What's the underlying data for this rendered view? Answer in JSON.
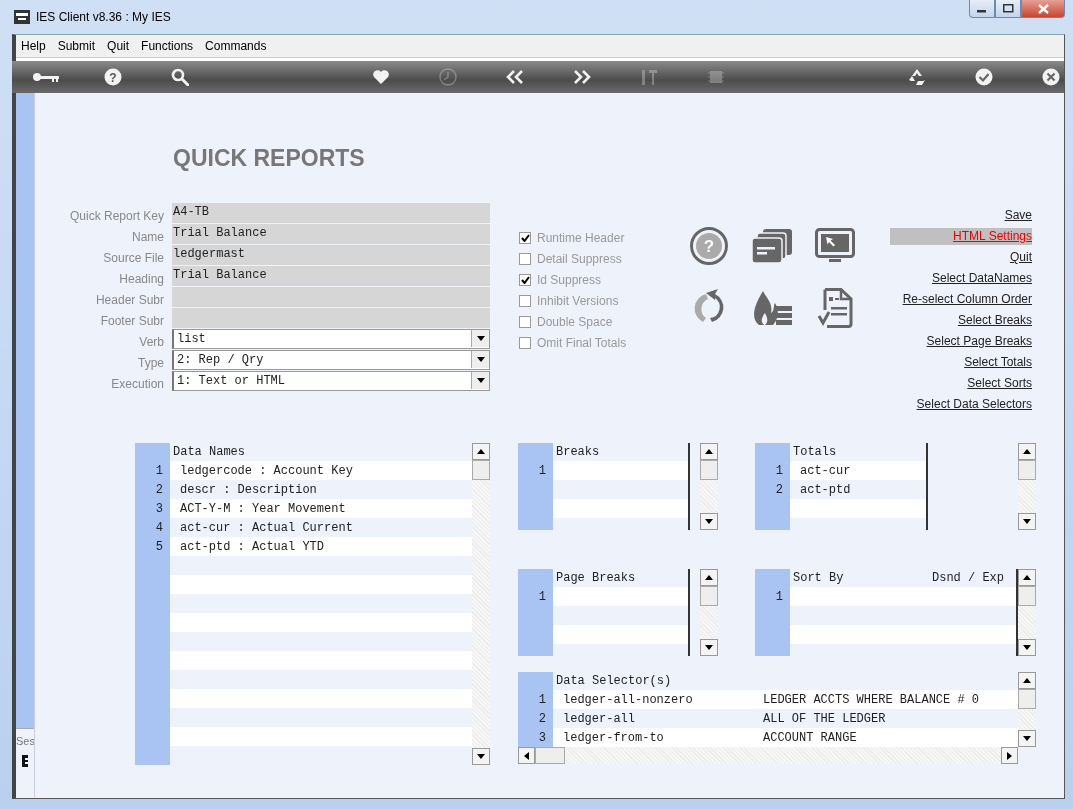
{
  "window": {
    "title": "IES Client v8.36 : My IES"
  },
  "menu": [
    "Help",
    "Submit",
    "Quit",
    "Functions",
    "Commands"
  ],
  "toolbar": {
    "left": [
      {
        "kind": "key",
        "disabled": false
      },
      {
        "kind": "help",
        "symbol": "?",
        "disabled": false
      },
      {
        "kind": "search",
        "disabled": false
      }
    ],
    "middle": [
      {
        "kind": "heart",
        "disabled": false
      },
      {
        "kind": "clock",
        "disabled": true
      },
      {
        "kind": "back",
        "disabled": false
      },
      {
        "kind": "forward",
        "disabled": false
      },
      {
        "kind": "tools",
        "disabled": true
      },
      {
        "kind": "chip",
        "disabled": true
      }
    ],
    "right": [
      {
        "kind": "recycle",
        "disabled": false
      },
      {
        "kind": "check",
        "disabled": false
      },
      {
        "kind": "close",
        "disabled": false
      }
    ]
  },
  "heading": "QUICK REPORTS",
  "fields": [
    {
      "label": "Quick Report Key",
      "value": "A4-TB",
      "kind": "text"
    },
    {
      "label": "Name",
      "value": "Trial Balance",
      "kind": "text"
    },
    {
      "label": "Source File",
      "value": "ledgermast",
      "kind": "text"
    },
    {
      "label": "Heading",
      "value": "Trial Balance",
      "kind": "text"
    },
    {
      "label": "Header Subr",
      "kind": "text"
    },
    {
      "label": "Footer Subr",
      "kind": "text"
    },
    {
      "label": "Verb",
      "value": "list",
      "kind": "dropdown"
    },
    {
      "label": "Type",
      "value": "2: Rep / Qry",
      "kind": "dropdown"
    },
    {
      "label": "Execution",
      "value": "1: Text or HTML",
      "kind": "dropdown"
    }
  ],
  "options": [
    {
      "label": "Runtime Header",
      "checked": true
    },
    {
      "label": "Detail Suppress",
      "checked": false
    },
    {
      "label": "Id Suppress",
      "checked": true
    },
    {
      "label": "Inhibit Versions",
      "checked": false
    },
    {
      "label": "Double Space",
      "checked": false
    },
    {
      "label": "Omit Final Totals",
      "checked": false
    }
  ],
  "action_icons": [
    {
      "kind": "help",
      "symbol": "?"
    },
    {
      "kind": "cards"
    },
    {
      "kind": "monitor"
    },
    {
      "kind": "refresh"
    },
    {
      "kind": "firewall"
    },
    {
      "kind": "checklist"
    }
  ],
  "links": [
    {
      "label": "Save",
      "selected": false
    },
    {
      "label": "HTML Settings",
      "selected": true
    },
    {
      "label": "Quit",
      "selected": false
    },
    {
      "label": "Select DataNames",
      "selected": false
    },
    {
      "label": "Re-select Column Order",
      "selected": false
    },
    {
      "label": "Select Breaks",
      "selected": false
    },
    {
      "label": "Select Page Breaks",
      "selected": false
    },
    {
      "label": "Select Totals",
      "selected": false
    },
    {
      "label": "Select Sorts",
      "selected": false
    },
    {
      "label": "Select Data Selectors",
      "selected": false
    }
  ],
  "data_names": {
    "columns": [
      "Data Names"
    ],
    "rows": [
      {
        "number": "1",
        "cells": [
          "ledgercode : Account Key"
        ]
      },
      {
        "number": "2",
        "cells": [
          "descr : Description"
        ]
      },
      {
        "number": "3",
        "cells": [
          "ACT-Y-M : Year Movement"
        ]
      },
      {
        "number": "4",
        "cells": [
          "act-cur : Actual Current"
        ]
      },
      {
        "number": "5",
        "cells": [
          "act-ptd : Actual YTD"
        ]
      }
    ]
  },
  "breaks": {
    "columns": [
      "Breaks"
    ],
    "rows": [
      {
        "number": "1"
      }
    ]
  },
  "totals": {
    "columns": [
      "Totals"
    ],
    "rows": [
      {
        "number": "1",
        "cells": [
          "act-cur"
        ]
      },
      {
        "number": "2",
        "cells": [
          "act-ptd"
        ]
      }
    ]
  },
  "page_breaks": {
    "columns": [
      "Page Breaks"
    ],
    "rows": [
      {
        "number": "1"
      }
    ]
  },
  "sort_by": {
    "columns": [
      "Sort By",
      "Dsnd / Exp"
    ],
    "rows": [
      {
        "number": "1"
      }
    ]
  },
  "data_selectors": {
    "columns": [
      "Data Selector(s)"
    ],
    "rows": [
      {
        "number": "1",
        "cells": [
          "ledger-all-nonzero",
          "LEDGER ACCTS WHERE BALANCE # 0"
        ]
      },
      {
        "number": "2",
        "cells": [
          "ledger-all",
          "ALL OF THE LEDGER"
        ]
      },
      {
        "number": "3",
        "cells": [
          "ledger-from-to",
          "ACCOUNT RANGE"
        ]
      }
    ]
  },
  "session": {
    "label": "Ses"
  }
}
